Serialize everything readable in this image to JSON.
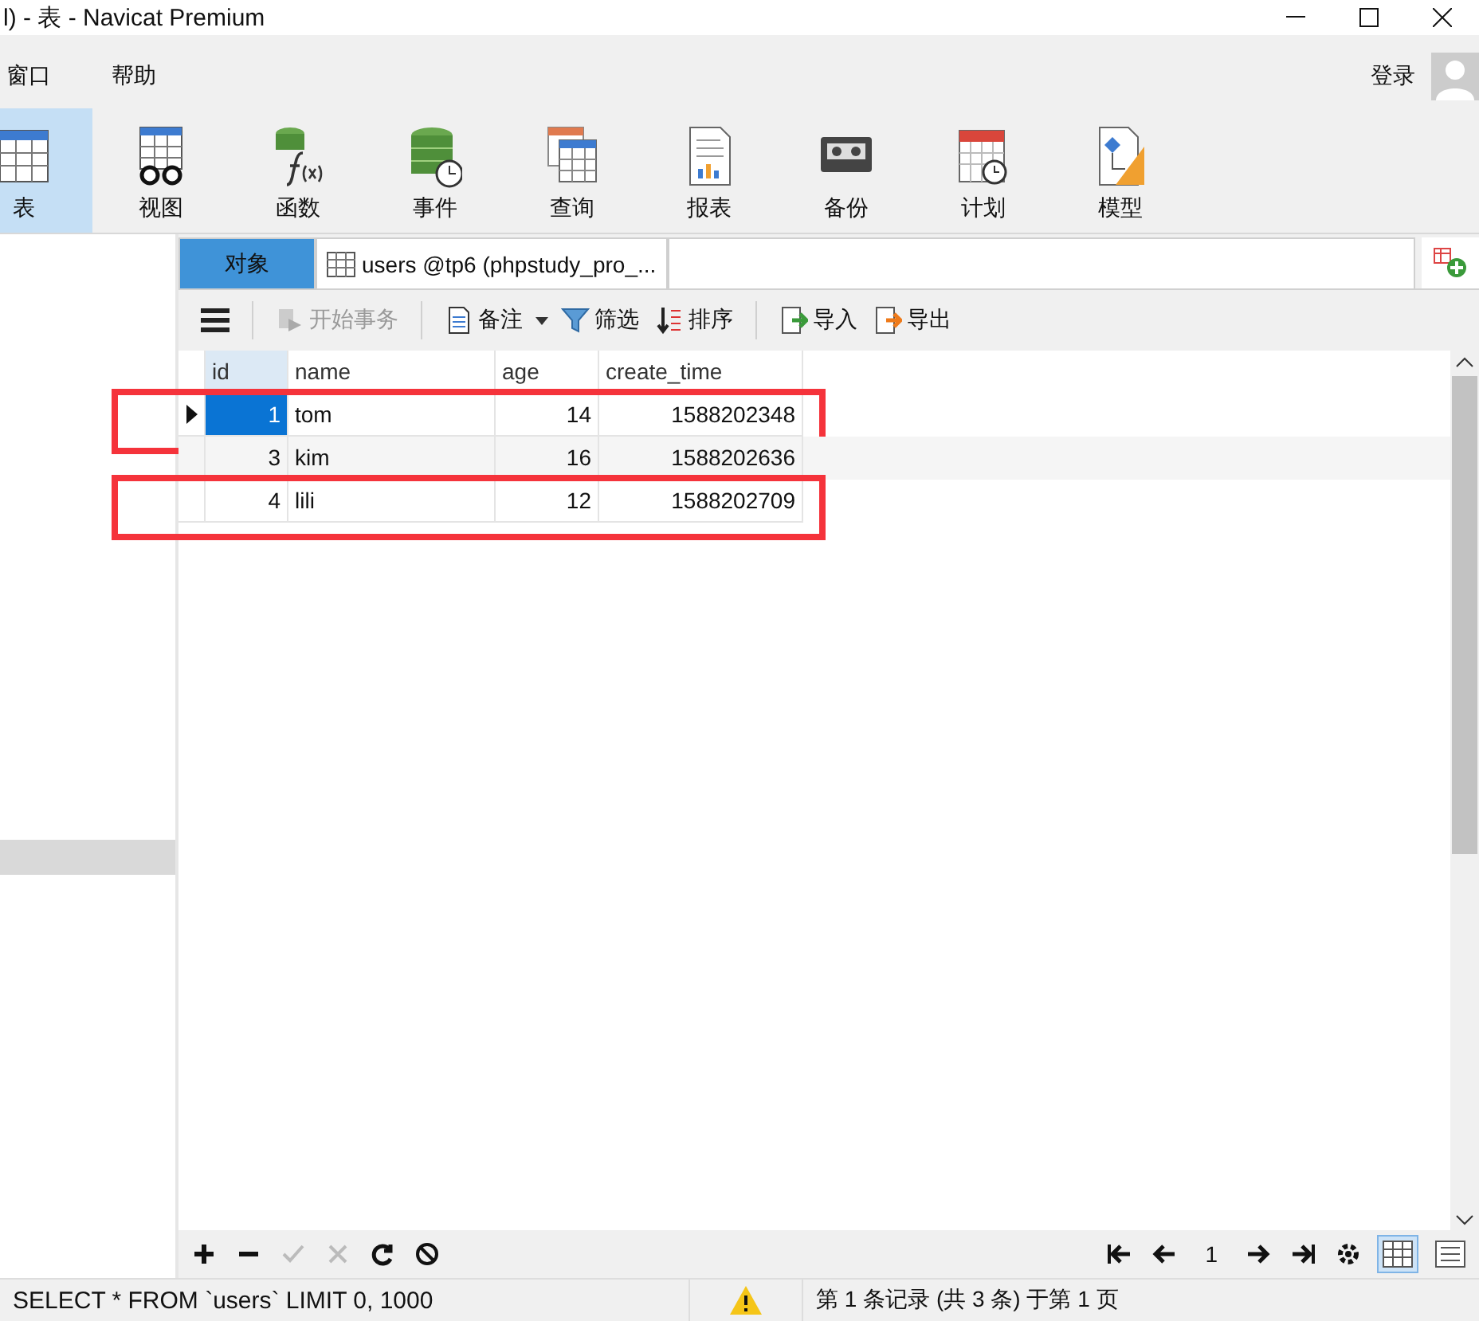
{
  "window": {
    "title": "l) - 表 - Navicat Premium"
  },
  "menu": [
    "窗口",
    "帮助"
  ],
  "account": {
    "label": "登录"
  },
  "toolbar": [
    {
      "kind": "table",
      "label": "表",
      "selected": true
    },
    {
      "kind": "view",
      "label": "视图",
      "selected": false
    },
    {
      "kind": "function",
      "label": "函数",
      "selected": false
    },
    {
      "kind": "event",
      "label": "事件",
      "selected": false
    },
    {
      "kind": "query",
      "label": "查询",
      "selected": false
    },
    {
      "kind": "report",
      "label": "报表",
      "selected": false
    },
    {
      "kind": "backup",
      "label": "备份",
      "selected": false
    },
    {
      "kind": "schedule",
      "label": "计划",
      "selected": false
    },
    {
      "kind": "model",
      "label": "模型",
      "selected": false
    }
  ],
  "tabs": [
    {
      "label": "对象",
      "selected": true,
      "kind": "objects"
    },
    {
      "label": "users @tp6 (phpstudy_pro_...",
      "selected": false,
      "kind": "table"
    }
  ],
  "grid_toolbar": [
    {
      "kind": "begin",
      "label": "开始事务",
      "disabled": true
    },
    {
      "kind": "note",
      "label": "备注",
      "disabled": false
    },
    {
      "kind": "filter",
      "label": "筛选",
      "disabled": false
    },
    {
      "kind": "sort",
      "label": "排序",
      "disabled": false
    },
    {
      "kind": "import",
      "label": "导入",
      "disabled": false
    },
    {
      "kind": "export",
      "label": "导出",
      "disabled": false
    }
  ],
  "table": {
    "columns": [
      "id",
      "name",
      "age",
      "create_time"
    ],
    "rows": [
      {
        "cells": [
          "1",
          "tom",
          "14",
          "1588202348"
        ],
        "selected": true,
        "highlighted": true
      },
      {
        "cells": [
          "3",
          "kim",
          "16",
          "1588202636"
        ],
        "selected": false,
        "highlighted": false
      },
      {
        "cells": [
          "4",
          "lili",
          "12",
          "1588202709"
        ],
        "selected": false,
        "highlighted": true
      }
    ]
  },
  "record_controls": {
    "disabled": [
      false,
      false,
      true,
      true,
      false,
      false
    ],
    "page": "1"
  },
  "status_bar": {
    "query": "SELECT * FROM `users` LIMIT 0, 1000",
    "records": "第 1 条记录 (共 3 条) 于第 1 页"
  }
}
